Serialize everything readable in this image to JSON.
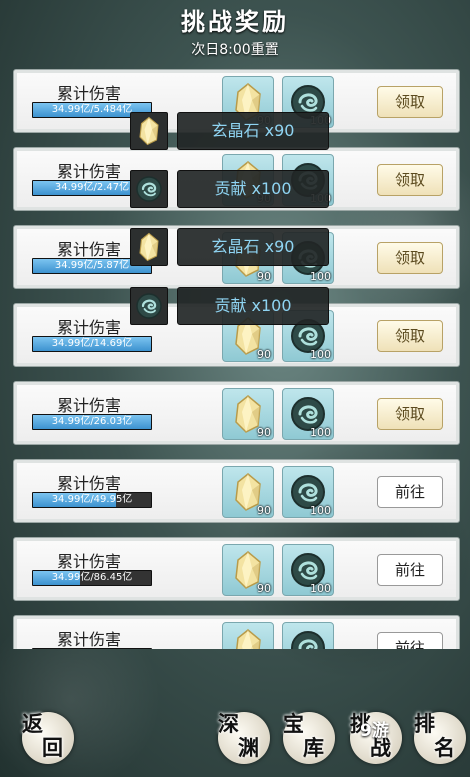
{
  "header": {
    "title": "挑战奖励",
    "subtitle": "次日8:00重置"
  },
  "rows": [
    {
      "label": "累计伤害",
      "progress_text": "34.99亿/5.484亿",
      "progress_fraction": 1.0,
      "crystal_count": "90",
      "token_count": "100",
      "button": "领取",
      "button_type": "claim"
    },
    {
      "label": "累计伤害",
      "progress_text": "34.99亿/2.47亿",
      "progress_fraction": 1.0,
      "crystal_count": "90",
      "token_count": "100",
      "button": "领取",
      "button_type": "claim"
    },
    {
      "label": "累计伤害",
      "progress_text": "34.99亿/5.87亿",
      "progress_fraction": 1.0,
      "crystal_count": "90",
      "token_count": "100",
      "button": "领取",
      "button_type": "claim"
    },
    {
      "label": "累计伤害",
      "progress_text": "34.99亿/14.69亿",
      "progress_fraction": 1.0,
      "crystal_count": "90",
      "token_count": "100",
      "button": "领取",
      "button_type": "claim"
    },
    {
      "label": "累计伤害",
      "progress_text": "34.99亿/26.03亿",
      "progress_fraction": 1.0,
      "crystal_count": "90",
      "token_count": "100",
      "button": "领取",
      "button_type": "claim"
    },
    {
      "label": "累计伤害",
      "progress_text": "34.99亿/49.95亿",
      "progress_fraction": 0.7,
      "crystal_count": "90",
      "token_count": "100",
      "button": "前往",
      "button_type": "go"
    },
    {
      "label": "累计伤害",
      "progress_text": "34.99亿/86.45亿",
      "progress_fraction": 0.4,
      "crystal_count": "90",
      "token_count": "100",
      "button": "前往",
      "button_type": "go"
    },
    {
      "label": "累计伤害",
      "progress_text": "",
      "progress_fraction": 0.25,
      "crystal_count": "",
      "token_count": "",
      "button": "前往",
      "button_type": "go"
    }
  ],
  "tooltips": [
    {
      "icon": "crystal-icon",
      "text": "玄晶石 x90"
    },
    {
      "icon": "contribution-icon",
      "text": "贡献 x100"
    },
    {
      "icon": "crystal-icon",
      "text": "玄晶石 x90"
    },
    {
      "icon": "contribution-icon",
      "text": "贡献 x100"
    }
  ],
  "bottom_nav": [
    {
      "name": "back",
      "text": "返回"
    },
    {
      "name": "abyss",
      "text": "深渊"
    },
    {
      "name": "treasury",
      "text": "宝库"
    },
    {
      "name": "challenge",
      "text": "挑战"
    },
    {
      "name": "ranking",
      "text": "排名"
    }
  ],
  "watermark": "9游",
  "colors": {
    "accent_blue": "#7cc4f0",
    "tooltip_text": "#8fd4f2",
    "claim_button": "#efe1b8"
  }
}
